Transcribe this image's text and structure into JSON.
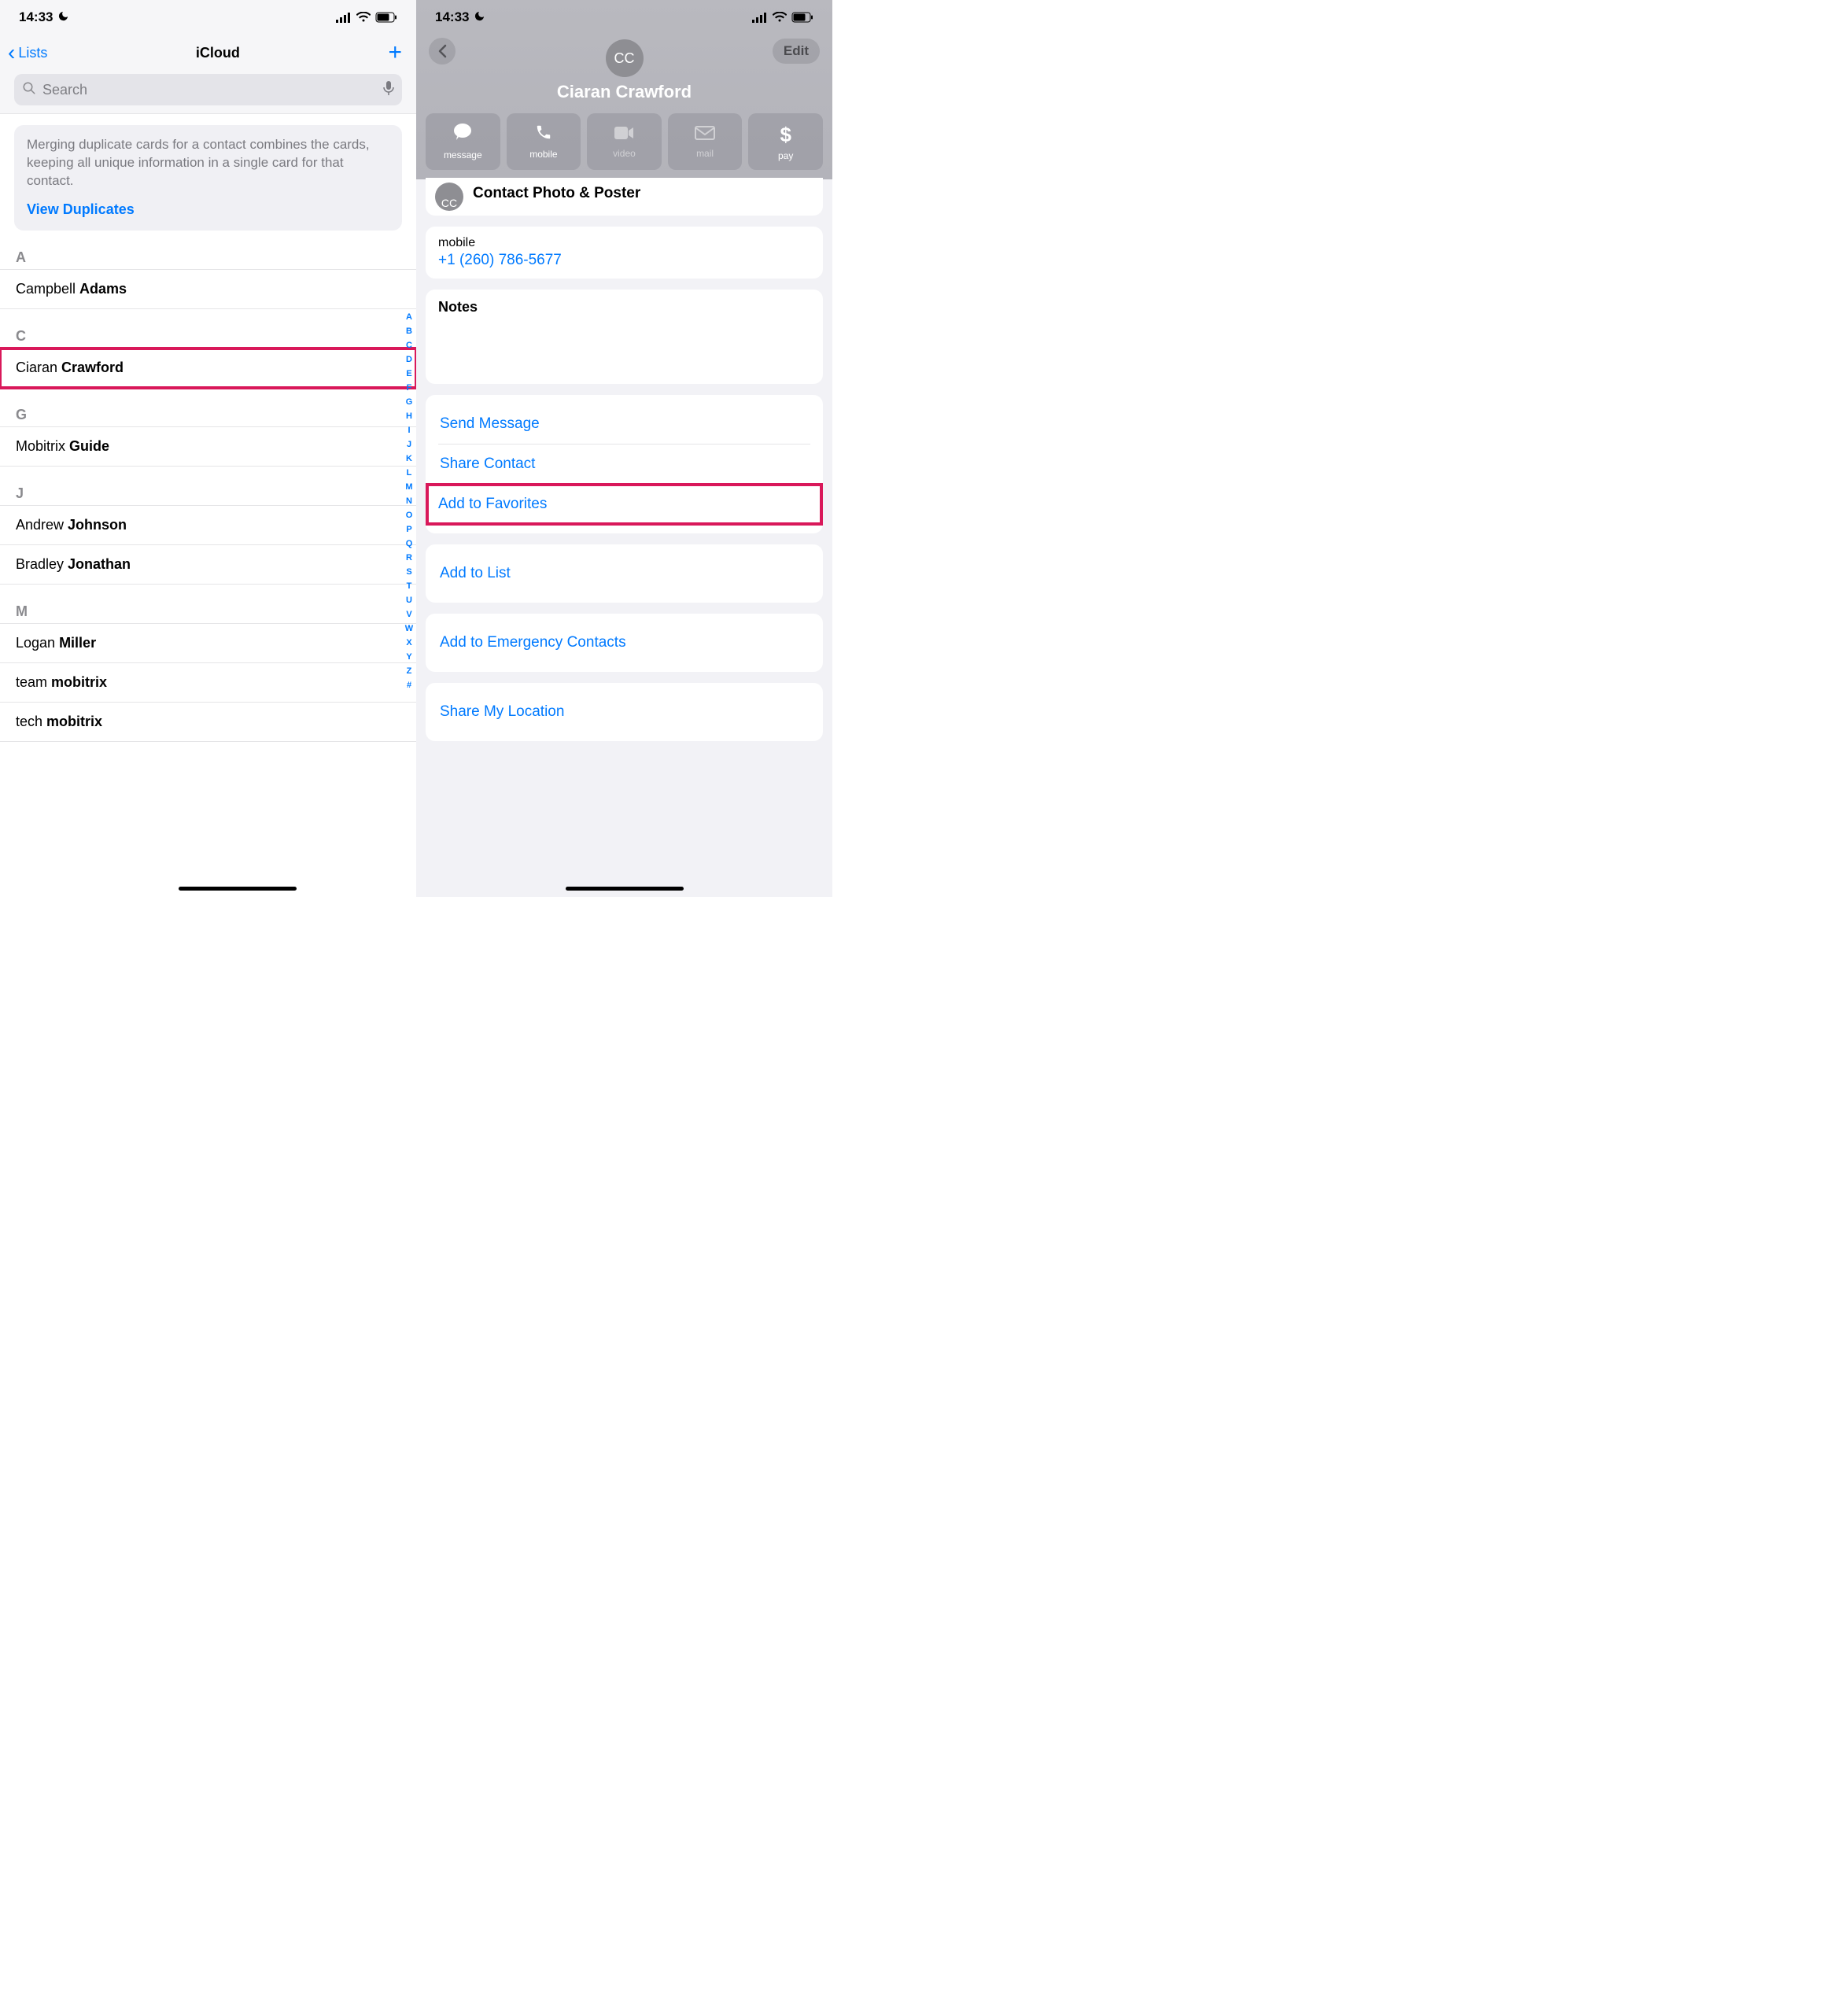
{
  "status": {
    "time": "14:33"
  },
  "left": {
    "back_label": "Lists",
    "title": "iCloud",
    "search_placeholder": "Search",
    "dup_text": "Merging duplicate cards for a contact combines the cards, keeping all unique information in a single card for that contact.",
    "dup_link": "View Duplicates",
    "sections": {
      "A": [
        {
          "first": "Campbell",
          "last": "Adams"
        }
      ],
      "C": [
        {
          "first": "Ciaran",
          "last": "Crawford",
          "highlighted": true
        }
      ],
      "G": [
        {
          "first": "Mobitrix",
          "last": "Guide"
        }
      ],
      "J": [
        {
          "first": "Andrew",
          "last": "Johnson"
        },
        {
          "first": "Bradley",
          "last": "Jonathan"
        }
      ],
      "M": [
        {
          "first": "Logan",
          "last": "Miller"
        },
        {
          "first": "team",
          "last": "mobitrix"
        },
        {
          "first": "tech",
          "last": "mobitrix"
        }
      ]
    },
    "index": [
      "A",
      "B",
      "C",
      "D",
      "E",
      "F",
      "G",
      "H",
      "I",
      "J",
      "K",
      "L",
      "M",
      "N",
      "O",
      "P",
      "Q",
      "R",
      "S",
      "T",
      "U",
      "V",
      "W",
      "X",
      "Y",
      "Z",
      "#"
    ]
  },
  "right": {
    "edit_label": "Edit",
    "initials": "CC",
    "name": "Ciaran Crawford",
    "actions": [
      {
        "key": "message",
        "label": "message",
        "enabled": true
      },
      {
        "key": "mobile",
        "label": "mobile",
        "enabled": true
      },
      {
        "key": "video",
        "label": "video",
        "enabled": false
      },
      {
        "key": "mail",
        "label": "mail",
        "enabled": false
      },
      {
        "key": "pay",
        "label": "pay",
        "enabled": true
      }
    ],
    "partial_row": "Contact Photo & Poster",
    "phone": {
      "label": "mobile",
      "value": "+1 (260) 786-5677"
    },
    "notes_label": "Notes",
    "list1": [
      "Send Message",
      "Share Contact",
      "Add to Favorites"
    ],
    "list2": [
      "Add to List"
    ],
    "list3": [
      "Add to Emergency Contacts"
    ],
    "list4": [
      "Share My Location"
    ]
  }
}
